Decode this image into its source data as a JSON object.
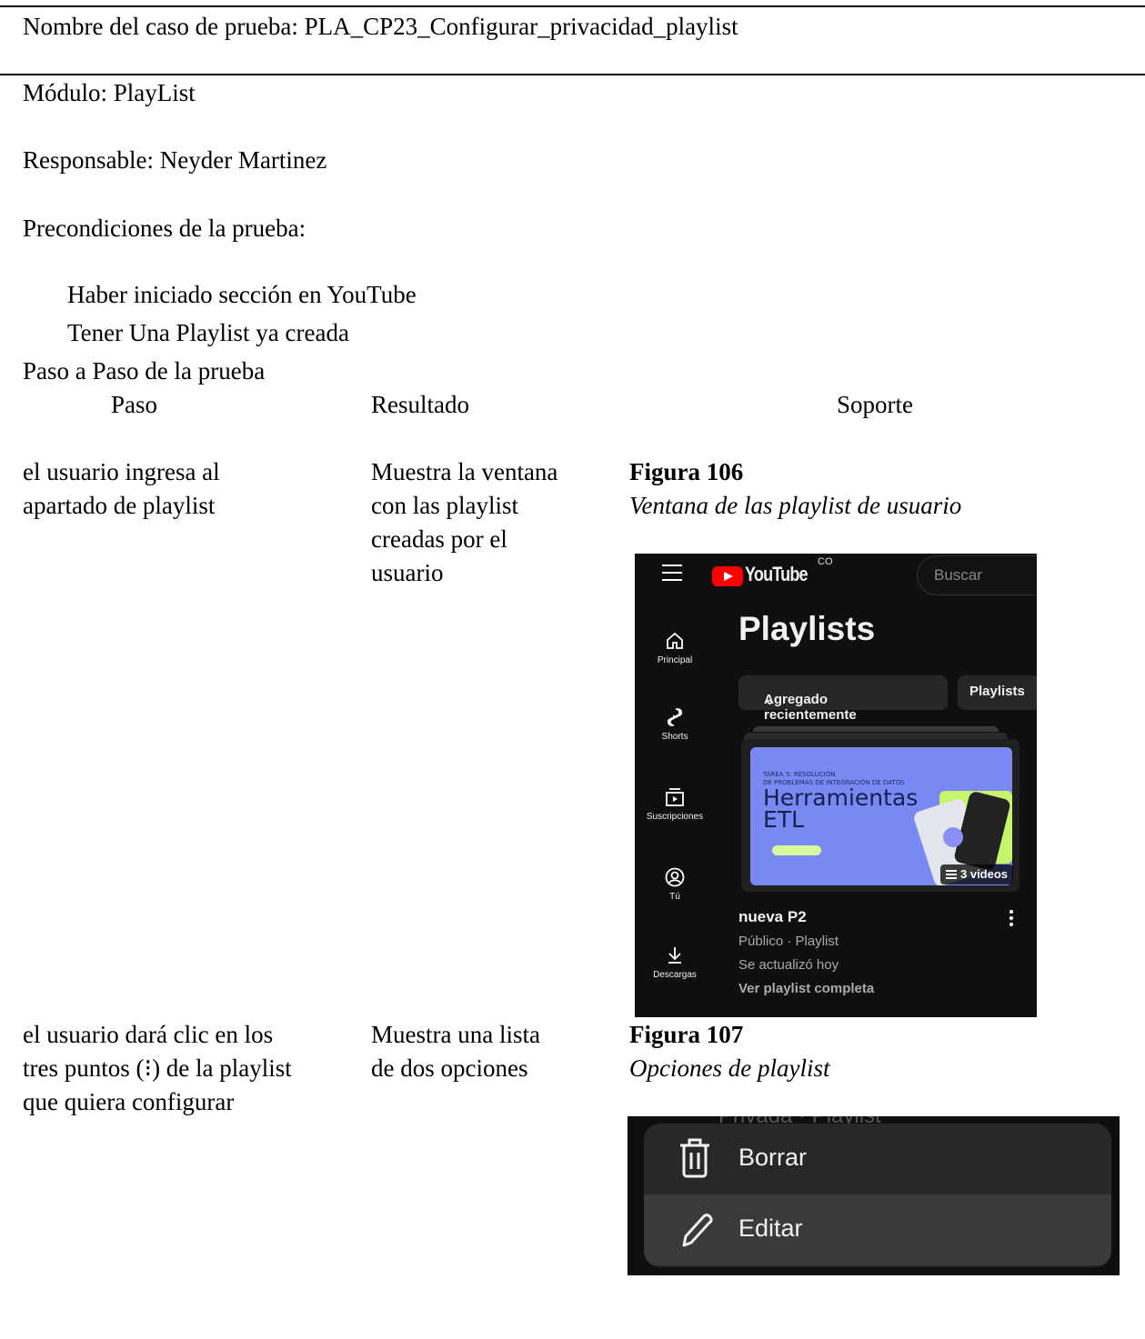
{
  "test_case": {
    "name": "Nombre del caso de prueba: PLA_CP23_Configurar_privacidad_playlist",
    "module": "Módulo: PlayList",
    "owner": "Responsable: Neyder Martinez",
    "preconditions_title": "Precondiciones de la prueba:",
    "preconditions": [
      "Haber iniciado sección en YouTube",
      "Tener Una Playlist ya creada"
    ],
    "steps_title": "Paso a Paso de la prueba",
    "columns": [
      "Paso",
      "Resultado",
      "Soporte"
    ]
  },
  "steps": [
    {
      "step": [
        "el usuario ingresa al",
        "apartado de playlist"
      ],
      "result": [
        "Muestra la ventana",
        "con las playlist",
        "creadas por el",
        "usuario"
      ],
      "figure_label": "Figura 106",
      "figure_caption": "Ventana de las playlist de usuario"
    },
    {
      "step": [
        "el usuario dará clic en los",
        "tres puntos (⁝) de la playlist",
        "que quiera configurar"
      ],
      "result": [
        "Muestra una lista",
        "de dos opciones"
      ],
      "figure_label": "Figura 107",
      "figure_caption": "Opciones de playlist"
    }
  ],
  "youtube_screenshot": {
    "logo_text": "YouTube",
    "country_code": "CO",
    "search_placeholder": "Buscar",
    "nav": [
      "Principal",
      "Shorts",
      "Suscripciones",
      "Tú",
      "Descargas"
    ],
    "page_title": "Playlists",
    "sort_chip": "Agregado recientemente",
    "filter_chip": "Playlists",
    "thumbnail": {
      "small_text_1": "TAREA 5: RESOLUCIÓN",
      "small_text_2": "DE PROBLEMAS DE INTEGRACIÓN DE DATOS",
      "big_text_1": "Herramientas",
      "big_text_2": "ETL"
    },
    "video_count": "3 videos",
    "playlist_title": "nueva P2",
    "playlist_visibility": "Público · Playlist",
    "playlist_updated": "Se actualizó hoy",
    "view_full": "Ver playlist completa",
    "colors": {
      "background": "#0f0f0f",
      "logo_red": "#ff0000",
      "thumbnail": "#7a89f2"
    }
  },
  "options_menu": {
    "ghost_text": "Privada · Playlist",
    "items": [
      {
        "label": "Borrar",
        "icon": "trash-icon"
      },
      {
        "label": "Editar",
        "icon": "pencil-icon"
      }
    ]
  }
}
